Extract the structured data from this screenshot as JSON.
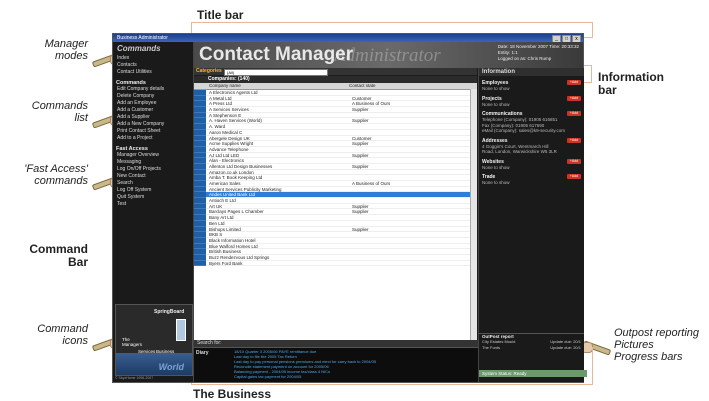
{
  "annotations": {
    "title_bar": "Title bar",
    "manager_modes": "Manager\nmodes",
    "commands_list": "Commands\nlist",
    "fast_access": "'Fast Access'\ncommands",
    "command_bar": "Command\nBar",
    "command_icons": "Command\nicons",
    "information_bar": "Information\nbar",
    "outpost": "Outpost reporting\nPictures\nProgress bars",
    "the_business": "The Business"
  },
  "window": {
    "title": "Business Administrator",
    "controls": [
      "_",
      "□",
      "x"
    ]
  },
  "banner": {
    "title": "Contact Manager",
    "ghost": "Administrator",
    "date_line": "Date: 18 November 2007   Time: 20:33:32",
    "entity_line": "Entity: 1:1",
    "logged_line": "Logged on as: Chris Rump"
  },
  "leftbar": {
    "header": "Commands",
    "modes": [
      "Index",
      "Contacts",
      "Contact Utilities"
    ],
    "commands_header": "Commands",
    "commands": [
      "Edit Company details",
      "Delete Company",
      "Add an Employee",
      "Add a Customer",
      "Add a Supplier",
      "Add a New Company",
      "Print Contact Sheet",
      "Add to a Project"
    ],
    "fast_header": "Fast Access",
    "fast": [
      "Manager Overview",
      "Messaging",
      "Log On/Off Projects",
      "New Contact",
      "Search",
      "Log Off System",
      "Quit System",
      "Test"
    ],
    "icons": {
      "springboard": "SpringBoard",
      "managers": "The\nManagers",
      "services": "Services",
      "business": "Business",
      "world": "World"
    },
    "copyright": "© SkyzHome 1996-2007"
  },
  "catbar": {
    "label": "Categories",
    "value": "(All)"
  },
  "grid": {
    "header": "Companies: (140)",
    "columns": [
      "Company name",
      "Contact state"
    ],
    "rows": [
      [
        "A Electronics Agents Ltd",
        ""
      ],
      [
        "A Metal Ltd",
        "Customer"
      ],
      [
        "A Press Ltd",
        "A Business of Ours"
      ],
      [
        "A Services Services",
        "Supplier"
      ],
      [
        "A Stephenson E",
        ""
      ],
      [
        "A. Haven Services (World)",
        "Supplier"
      ],
      [
        "A. Ward",
        ""
      ],
      [
        "Aaron Medical C",
        ""
      ],
      [
        "Abergele Design UK",
        "Customer"
      ],
      [
        "Acme Supplies Wright",
        "Supplier"
      ],
      [
        "Advance Telephone",
        ""
      ],
      [
        "AJ Ltd Ltd LED",
        "Supplier"
      ],
      [
        "Alan - Electronics",
        ""
      ],
      [
        "Allenton Ltd Design Businesses",
        "Supplier"
      ],
      [
        "Amazon.co.uk London",
        ""
      ],
      [
        "Amba T. Book Keeping Ltd",
        ""
      ],
      [
        "American Sales",
        "A Business of Ours"
      ],
      [
        "Ancient Services Publicity Marketing",
        ""
      ],
      [
        "Andes United Bank Ltd",
        ""
      ],
      [
        "Antioch E Ltd",
        ""
      ],
      [
        "Art UK",
        "Supplier"
      ],
      [
        "Barclays Pages L Chamber",
        "Supplier"
      ],
      [
        "Bany Art Ltd",
        ""
      ],
      [
        "Ben Ltd",
        ""
      ],
      [
        "Bishops Limited",
        "Supplier"
      ],
      [
        "BKB S",
        ""
      ],
      [
        "Black Information Hotel",
        ""
      ],
      [
        "Blue Walford Homes Ltd",
        ""
      ],
      [
        "British Business",
        ""
      ],
      [
        "Buzz Rendezvous Ltd Springs",
        ""
      ],
      [
        "Byers Ford Bank",
        ""
      ]
    ],
    "selected_index": 18
  },
  "search": {
    "label": "Search for: "
  },
  "diary": {
    "label": "Diary",
    "lines": [
      "18/10 Quarter 3 2005/06 PAYE remittance due",
      "Last day to file the 2005 Tax Return",
      "Last day to pay personal pensions premiums and elect for carry back to 2004/05",
      "Reconcile statement payment on account for 2005/06",
      "Balancing payment - 2004/05 income tax/class 4 NICs",
      "Capital gains tax payment for 2004/05"
    ]
  },
  "rightbar": {
    "header": "Information",
    "add_label": "+Add",
    "sections": [
      {
        "title": "Employees",
        "lines": [
          "None to show"
        ]
      },
      {
        "title": "Projects",
        "lines": [
          "None to show"
        ]
      },
      {
        "title": "Communications",
        "lines": [
          "Telephone (Company): 01905 616851",
          "Fax (Company): 01905 617690",
          "eMail (Company): sales@k9-security.com"
        ]
      },
      {
        "title": "Addresses",
        "lines": [
          "4 Goggin's Court, Wentmarch Hill",
          "Road, London, Warwickshire W5 3LR"
        ]
      },
      {
        "title": "Websites",
        "lines": [
          "None to show"
        ]
      },
      {
        "title": "Trade",
        "lines": [
          "None to show"
        ]
      }
    ],
    "outpost": {
      "header": "OutPost report",
      "rows": [
        [
          "City Estates Mould",
          "Update due: 20/1"
        ],
        [
          "The Fonts",
          "Update due: 20/1"
        ]
      ]
    },
    "status": "System Status: Ready"
  }
}
